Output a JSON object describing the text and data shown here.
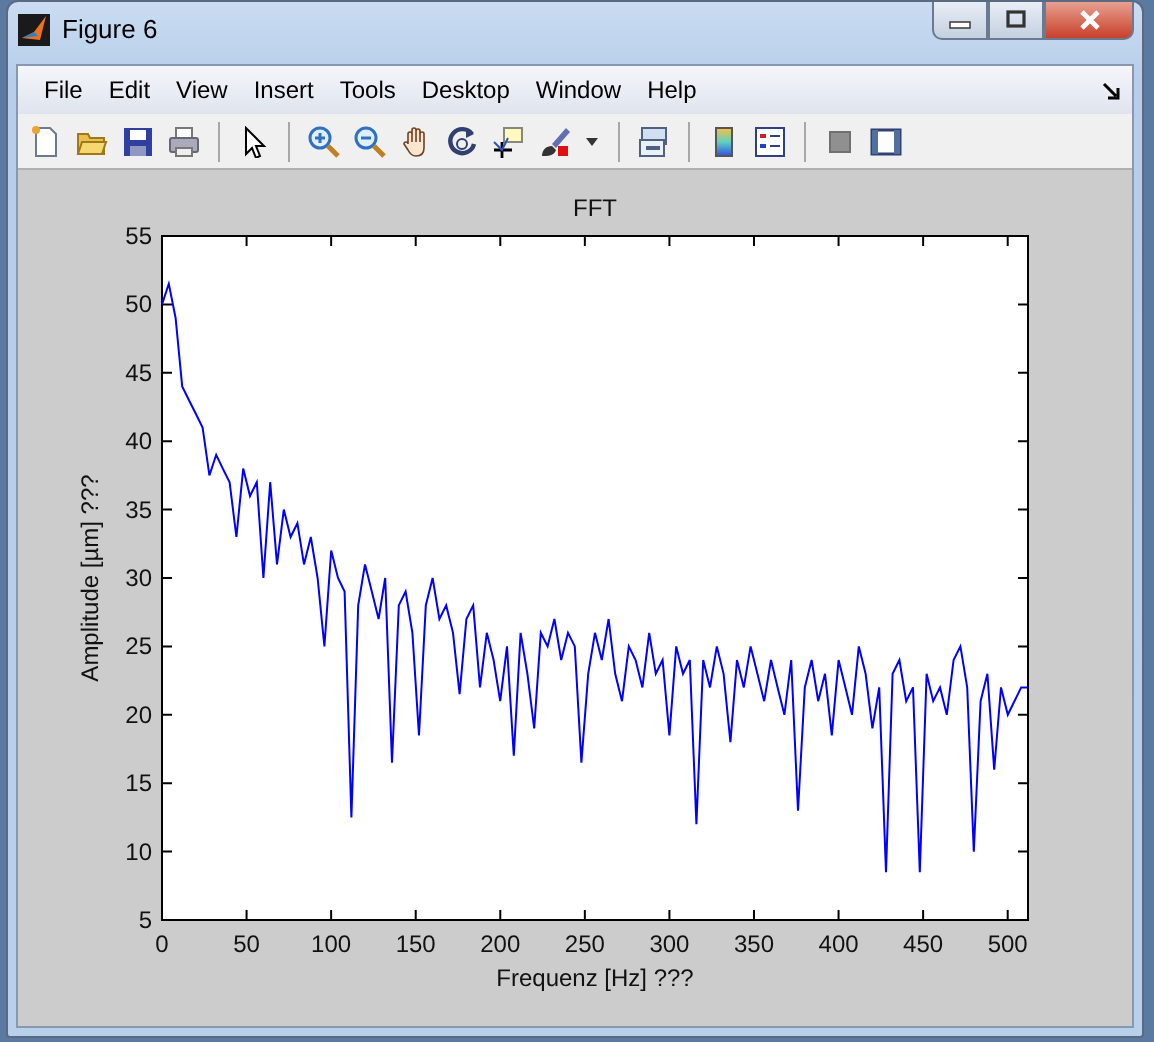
{
  "window": {
    "title": "Figure 6"
  },
  "menu": [
    "File",
    "Edit",
    "View",
    "Insert",
    "Tools",
    "Desktop",
    "Window",
    "Help"
  ],
  "plot": {
    "chart_data": {
      "type": "line",
      "title": "FFT",
      "xlabel": "Frequenz [Hz] ???",
      "ylabel": "Amplitude [µm] ???",
      "xlim": [
        0,
        512
      ],
      "ylim": [
        5,
        55
      ],
      "xticks": [
        0,
        50,
        100,
        150,
        200,
        250,
        300,
        350,
        400,
        450,
        500
      ],
      "yticks": [
        5,
        10,
        15,
        20,
        25,
        30,
        35,
        40,
        45,
        50,
        55
      ],
      "x": [
        0,
        4,
        8,
        12,
        16,
        20,
        24,
        28,
        32,
        36,
        40,
        44,
        48,
        52,
        56,
        60,
        64,
        68,
        72,
        76,
        80,
        84,
        88,
        92,
        96,
        100,
        104,
        108,
        112,
        116,
        120,
        124,
        128,
        132,
        136,
        140,
        144,
        148,
        152,
        156,
        160,
        164,
        168,
        172,
        176,
        180,
        184,
        188,
        192,
        196,
        200,
        204,
        208,
        212,
        216,
        220,
        224,
        228,
        232,
        236,
        240,
        244,
        248,
        252,
        256,
        260,
        264,
        268,
        272,
        276,
        280,
        284,
        288,
        292,
        296,
        300,
        304,
        308,
        312,
        316,
        320,
        324,
        328,
        332,
        336,
        340,
        344,
        348,
        352,
        356,
        360,
        364,
        368,
        372,
        376,
        380,
        384,
        388,
        392,
        396,
        400,
        404,
        408,
        412,
        416,
        420,
        424,
        428,
        432,
        436,
        440,
        444,
        448,
        452,
        456,
        460,
        464,
        468,
        472,
        476,
        480,
        484,
        488,
        492,
        496,
        500,
        504,
        508,
        512
      ],
      "series": [
        {
          "color": "#0000ff",
          "values": [
            50,
            51.5,
            49,
            44,
            43,
            42,
            41,
            37.5,
            39,
            38,
            37,
            33,
            38,
            36,
            37,
            30,
            37,
            31,
            35,
            33,
            34,
            31,
            33,
            30,
            25,
            32,
            30,
            29,
            12.5,
            28,
            31,
            29,
            27,
            30,
            16.5,
            28,
            29,
            26,
            18.5,
            28,
            30,
            27,
            28,
            26,
            21.5,
            27,
            28,
            22,
            26,
            24,
            21,
            25,
            17,
            26,
            23,
            19,
            26,
            25,
            27,
            24,
            26,
            25,
            16.5,
            23,
            26,
            24,
            27,
            23,
            21,
            25,
            24,
            22,
            26,
            23,
            24,
            18.5,
            25,
            23,
            24,
            12,
            24,
            22,
            25,
            23,
            18,
            24,
            22,
            25,
            23,
            21,
            24,
            22,
            20,
            24,
            13,
            22,
            24,
            21,
            23,
            18.5,
            24,
            22,
            20,
            25,
            23,
            19,
            22,
            8.5,
            23,
            24,
            21,
            22,
            8.5,
            23,
            21,
            22,
            20,
            24,
            25,
            22,
            10,
            21,
            23,
            16,
            22,
            20,
            21,
            22,
            22
          ]
        }
      ]
    }
  }
}
